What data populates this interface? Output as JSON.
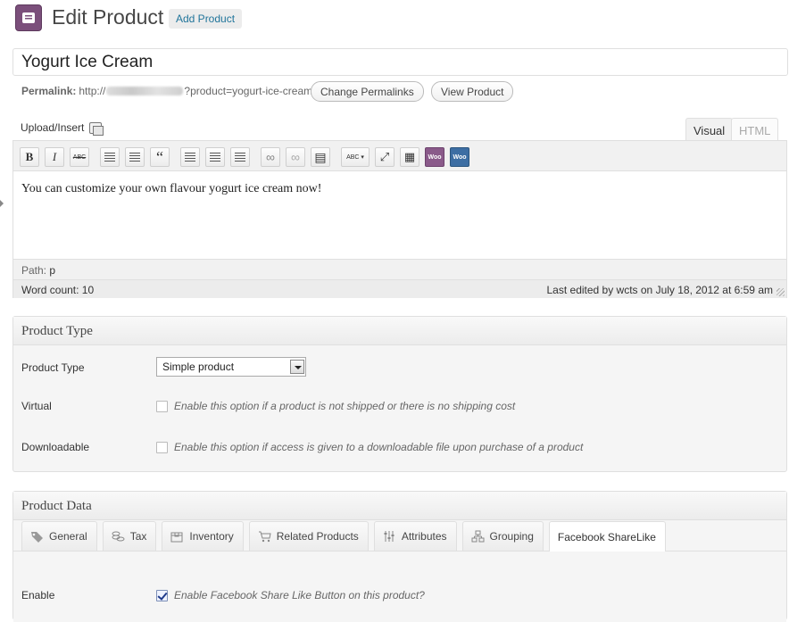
{
  "header": {
    "title": "Edit Product",
    "add_new_label": "Add Product",
    "icon": "cart-icon"
  },
  "title_field": {
    "value": "Yogurt Ice Cream"
  },
  "permalink": {
    "label": "Permalink:",
    "prefix": "http://",
    "suffix": "?product=yogurt-ice-cream",
    "change_button": "Change Permalinks",
    "view_button": "View Product"
  },
  "editor": {
    "upload_label": "Upload/Insert",
    "tabs": {
      "visual": "Visual",
      "html": "HTML"
    },
    "toolbar": [
      {
        "name": "bold-icon",
        "glyph": "B"
      },
      {
        "name": "italic-icon",
        "glyph": "I"
      },
      {
        "name": "strikethrough-icon",
        "glyph": "ABC"
      },
      {
        "name": "bullet-list-icon",
        "glyph": "≡"
      },
      {
        "name": "numbered-list-icon",
        "glyph": "≡"
      },
      {
        "name": "blockquote-icon",
        "glyph": "“"
      },
      {
        "name": "align-left-icon",
        "glyph": "≡"
      },
      {
        "name": "align-center-icon",
        "glyph": "≡"
      },
      {
        "name": "align-right-icon",
        "glyph": "≡"
      },
      {
        "name": "link-icon",
        "glyph": "∞"
      },
      {
        "name": "unlink-icon",
        "glyph": "∞"
      },
      {
        "name": "more-tag-icon",
        "glyph": "▤"
      },
      {
        "name": "spellcheck-icon",
        "glyph": "ABC"
      },
      {
        "name": "fullscreen-icon",
        "glyph": "⤢"
      },
      {
        "name": "kitchen-sink-icon",
        "glyph": "▦"
      },
      {
        "name": "woo-shortcode-icon",
        "glyph": "Woo"
      },
      {
        "name": "woo-blue-icon",
        "glyph": "Woo"
      }
    ],
    "content": "You can customize your own flavour yogurt ice cream now!",
    "path_label": "Path:",
    "path_value": "p",
    "word_count": "Word count: 10",
    "last_edited": "Last edited by wcts on July 18, 2012 at 6:59 am"
  },
  "product_type": {
    "heading": "Product Type",
    "type_label": "Product Type",
    "type_value": "Simple product",
    "virtual_label": "Virtual",
    "virtual_text": "Enable this option if a product is not shipped or there is no shipping cost",
    "virtual_checked": false,
    "downloadable_label": "Downloadable",
    "downloadable_text": "Enable this option if access is given to a downloadable file upon purchase of a product",
    "downloadable_checked": false
  },
  "product_data": {
    "heading": "Product Data",
    "tabs": [
      {
        "label": "General",
        "icon": "tag-icon"
      },
      {
        "label": "Tax",
        "icon": "coins-icon"
      },
      {
        "label": "Inventory",
        "icon": "box-icon"
      },
      {
        "label": "Related Products",
        "icon": "cart-icon"
      },
      {
        "label": "Attributes",
        "icon": "attributes-icon"
      },
      {
        "label": "Grouping",
        "icon": "grouping-icon"
      },
      {
        "label": "Facebook ShareLike",
        "icon": ""
      }
    ],
    "active_tab": "Facebook ShareLike",
    "enable_label": "Enable",
    "enable_text": "Enable Facebook Share Like Button on this product?",
    "enable_checked": true
  }
}
